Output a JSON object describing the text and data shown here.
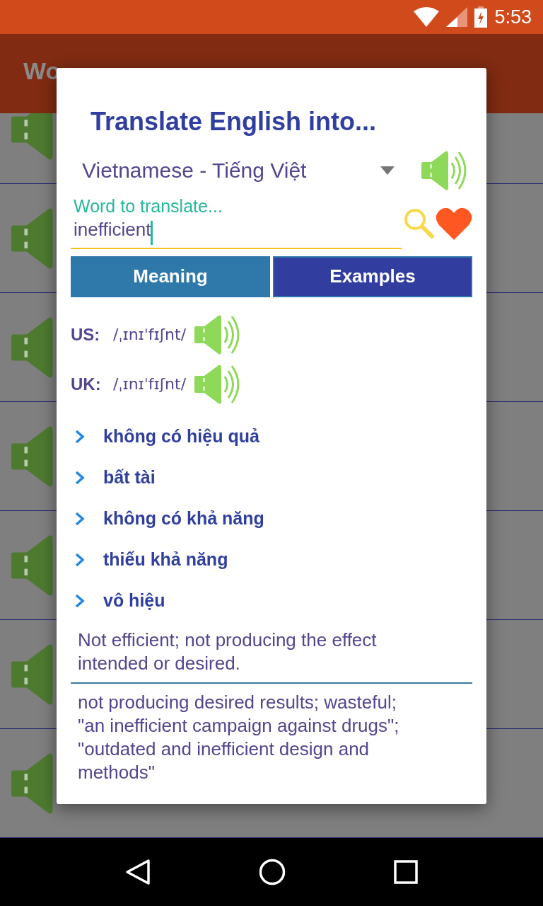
{
  "status_bar": {
    "time": "5:53"
  },
  "app_bar": {
    "title": "Wo"
  },
  "dialog": {
    "title": "Translate English into...",
    "language": "Vietnamese - Tiếng Việt",
    "word_field": {
      "placeholder": "Word to translate...",
      "value": "inefficient"
    },
    "tabs": [
      {
        "label": "Meaning",
        "selected": true
      },
      {
        "label": "Examples",
        "selected": false
      }
    ],
    "pronunciations": [
      {
        "label": "US:",
        "ipa": "/ˌɪnɪˈfɪʃnt/"
      },
      {
        "label": "UK:",
        "ipa": "/ˌɪnɪˈfɪʃnt/"
      }
    ],
    "meanings": [
      "không có hiệu quả",
      "bất tài",
      "không có khả năng",
      "thiếu khả năng",
      "vô hiệu"
    ],
    "definitions": [
      "Not efficient; not producing the effect intended or desired.",
      "not producing desired results; wasteful; \"an inefficient campaign against drugs\"; \"outdated and inefficient design and methods\""
    ]
  }
}
